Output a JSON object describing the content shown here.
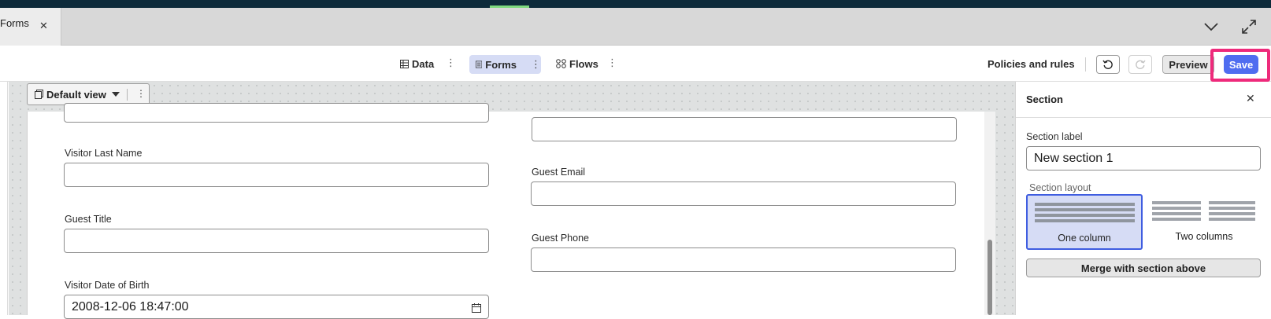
{
  "tab": {
    "label": "Forms",
    "close": "✕"
  },
  "toolbar": {
    "data_label": "Data",
    "forms_label": "Forms",
    "flows_label": "Flows",
    "kebab": "⋮",
    "policies_label": "Policies and rules",
    "preview_label": "Preview",
    "save_label": "Save"
  },
  "view": {
    "label": "Default view",
    "kebab": "⋮"
  },
  "form": {
    "left": [
      {
        "label": "Visitor Last Name",
        "value": ""
      },
      {
        "label": "Guest Title",
        "value": ""
      },
      {
        "label": "Visitor Date of Birth",
        "value": "2008-12-06 18:47:00"
      }
    ],
    "right": [
      {
        "label": "Guest Email",
        "value": ""
      },
      {
        "label": "Guest Phone",
        "value": ""
      }
    ]
  },
  "panel": {
    "title": "Section",
    "close": "✕",
    "section_label_caption": "Section label",
    "section_label_value": "New section 1",
    "layout_caption": "Section layout",
    "layout_options": [
      "One column",
      "Two columns"
    ],
    "selected_layout": "One column",
    "merge_label": "Merge with section above"
  },
  "colors": {
    "accent": "#4f6df0",
    "highlight": "#ee2a7b",
    "selected_bg": "#d6dcf5"
  }
}
